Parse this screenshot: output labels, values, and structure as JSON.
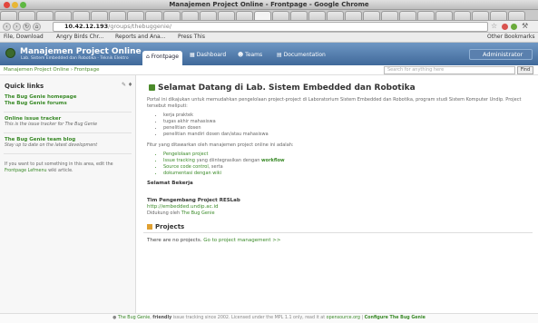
{
  "window": {
    "title": "Manajemen Project Online - Frontpage - Google Chrome"
  },
  "tabs": [
    "",
    "",
    "",
    "",
    "",
    "",
    "",
    "",
    "",
    "",
    "",
    "",
    "",
    "",
    "",
    "",
    "",
    "",
    "",
    "",
    "",
    "",
    "",
    "",
    "",
    "",
    "",
    "",
    ""
  ],
  "address": {
    "host": "10.42.12.193",
    "path": "/groups/thebuggenie/"
  },
  "bookmarks": {
    "file_download": "File, Download",
    "angry_birds": "Angry Birds Chr...",
    "reports": "Reports and Ana...",
    "press_this": "Press This",
    "other": "Other Bookmarks"
  },
  "site": {
    "name": "Manajemen Project Online",
    "subtitle": "Lab. Sistem Embedded dan Robotika - Teknik Elektro",
    "nav": {
      "frontpage": "Frontpage",
      "dashboard": "Dashboard",
      "teams": "Teams",
      "documentation": "Documentation"
    },
    "admin": "Administrator"
  },
  "breadcrumb": "Manajemen Project Online › Frontpage",
  "search": {
    "placeholder": "Search for anything here",
    "button": "Find"
  },
  "sidebar": {
    "title": "Quick links",
    "links": {
      "homepage": "The Bug Genie homepage",
      "forums": "The Bug Genie forums",
      "tracker": "Online issue tracker",
      "blog": "The Bug Genie team blog"
    },
    "tracker_desc": "This is the issue tracker for The Bug Genie",
    "blog_desc": "Stay up to date on the latest development",
    "note_text": "If you want to put something in this area, edit the",
    "note_link": "Frontpage Lefmenu",
    "note_end": "wiki article."
  },
  "main": {
    "heading": "Selamat Datang di Lab. Sistem Embedded dan Robotika",
    "intro": "Portal ini dikajukan untuk memudahkan pengelolaan project-project di Laboratorium Sistem Embedded dan Robotika, program studi Sistem Komputer Undip. Project tersebut meliputi:",
    "items": [
      "kerja praktek",
      "tugas akhir mahasiswa",
      "penelitian dosen",
      "penelitian mandiri dosen dan/atau mahasiswa"
    ],
    "features_intro": "Fitur yang ditawarkan oleh manajemen project online ini adalah:",
    "features": {
      "f1": "Pengelolaan project",
      "f2a": "Issue tracking",
      "f2b": " yang diintegrasikan dengan ",
      "f2c": "workflow",
      "f3a": "Source code control",
      "f3b": ", serta",
      "f4": "dokumentasi dengan wiki"
    },
    "closing": "Selamat Bekerja",
    "team_name": "Tim Pengembang Project RESLab",
    "team_url": "http://embedded.undip.ac.id",
    "powered_prefix": "Didukung oleh",
    "powered_link": "The Bug Genie",
    "projects_title": "Projects",
    "no_projects": "There are no projects.",
    "project_mgmt_link": "Go to project management >>"
  },
  "footer": {
    "link": "The Bug Genie",
    "friendly": "friendly",
    "text": "issue tracking since 2002. Licensed under the MPL 1.1 only, read it at",
    "license_link": "opensource.org",
    "configure": "Configure The Bug Genie"
  },
  "colors": {
    "header": "#4f78a8",
    "link": "#3a8a28"
  }
}
